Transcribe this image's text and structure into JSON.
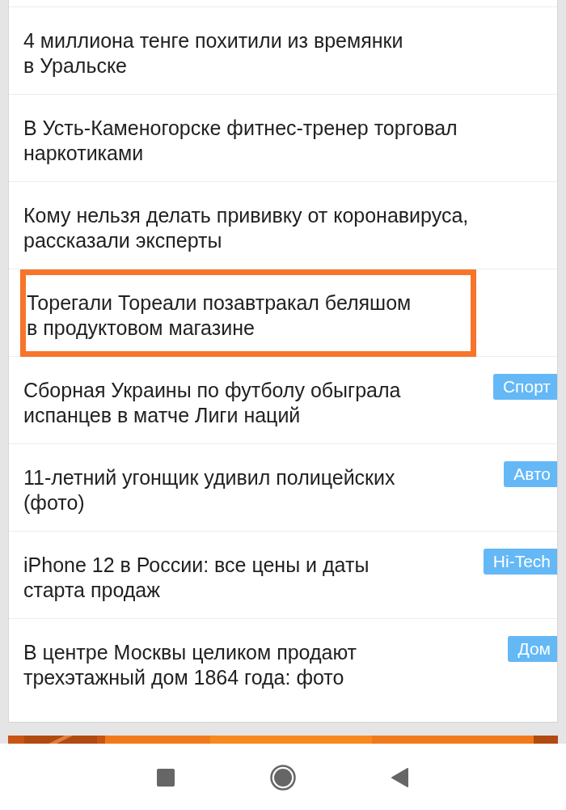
{
  "news": [
    {
      "title": "4 миллиона тенге похитили из времянки\nв Уральске",
      "highlighted": false
    },
    {
      "title": "В Усть-Каменогорске фитнес-тренер торговал\nнаркотиками",
      "highlighted": false
    },
    {
      "title": "Кому нельзя делать прививку от коронавируса,\nрассказали эксперты",
      "highlighted": false
    },
    {
      "title": "Торегали Тореали позавтракал беляшом\nв продуктовом магазине",
      "highlighted": true
    },
    {
      "title": "Сборная Украины по футболу обыграла\nиспанцев в матче Лиги наций",
      "highlighted": false,
      "tag": "Спорт"
    },
    {
      "title": "11-летний угонщик удивил полицейских\n(фото)",
      "highlighted": false,
      "tag": "Авто"
    },
    {
      "title": "iPhone 12 в России: все цены и даты\nстарта продаж",
      "highlighted": false,
      "tag": "Hi-Tech"
    },
    {
      "title": "В центре Москвы целиком продают\nтрехэтажный дом 1864 года: фото",
      "highlighted": false,
      "tag": "Дом"
    }
  ]
}
